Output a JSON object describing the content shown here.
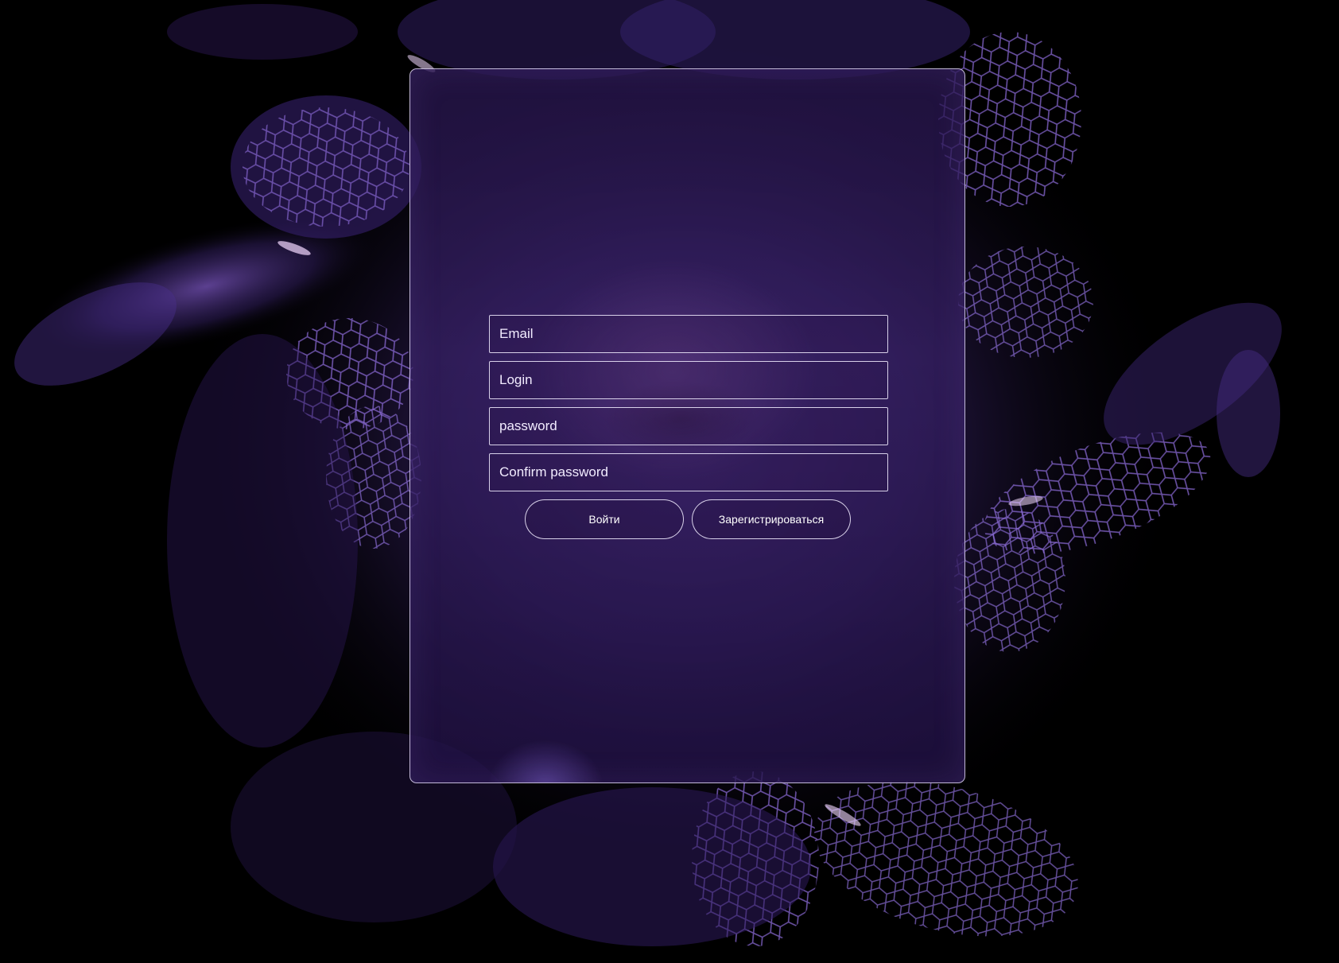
{
  "form": {
    "email_placeholder": "Email",
    "login_placeholder": "Login",
    "password_placeholder": "password",
    "confirm_password_placeholder": "Confirm password",
    "login_button_label": "Войти",
    "register_button_label": "Зарегистрироваться"
  },
  "theme": {
    "background": "#000000",
    "accent": "#5a3a9a",
    "border": "#e6def8",
    "text": "#ffffff"
  }
}
